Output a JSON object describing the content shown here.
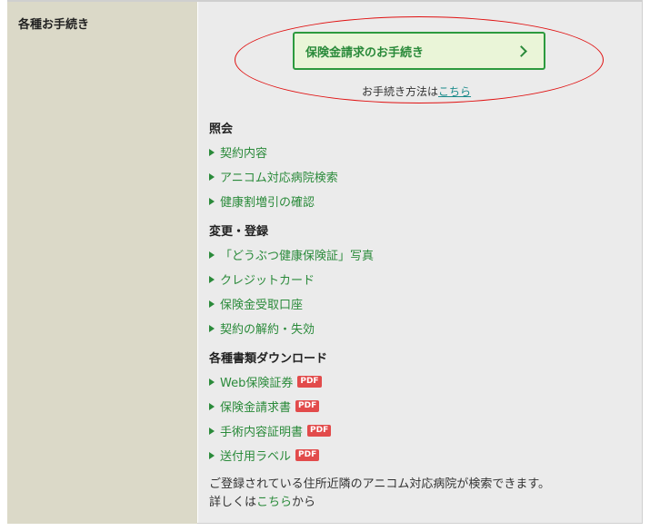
{
  "left": {
    "title": "各種お手続き"
  },
  "claim": {
    "button_label": "保険金請求のお手続き",
    "method_prefix": "お手続き方法は",
    "method_link": "こちら"
  },
  "sections": {
    "inquiry": {
      "title": "照会",
      "items": [
        "契約内容",
        "アニコム対応病院検索",
        "健康割増引の確認"
      ]
    },
    "change": {
      "title": "変更・登録",
      "items": [
        "「どうぶつ健康保険証」写真",
        "クレジットカード",
        "保険金受取口座",
        "契約の解約・失効"
      ]
    },
    "download": {
      "title": "各種書類ダウンロード",
      "items": [
        "Web保険証券",
        "保険金請求書",
        "手術内容証明書",
        "送付用ラベル"
      ],
      "pdf_label": "PDF"
    }
  },
  "note": {
    "line1": "ご登録されている住所近隣のアニコム対応病院が検索できます。",
    "line2_prefix": "詳しくは",
    "line2_link": "こちら",
    "line2_suffix": "から"
  },
  "colors": {
    "accent_green": "#2a8a3a",
    "highlight_red": "#e01010",
    "pdf_red": "#e24b4b"
  }
}
